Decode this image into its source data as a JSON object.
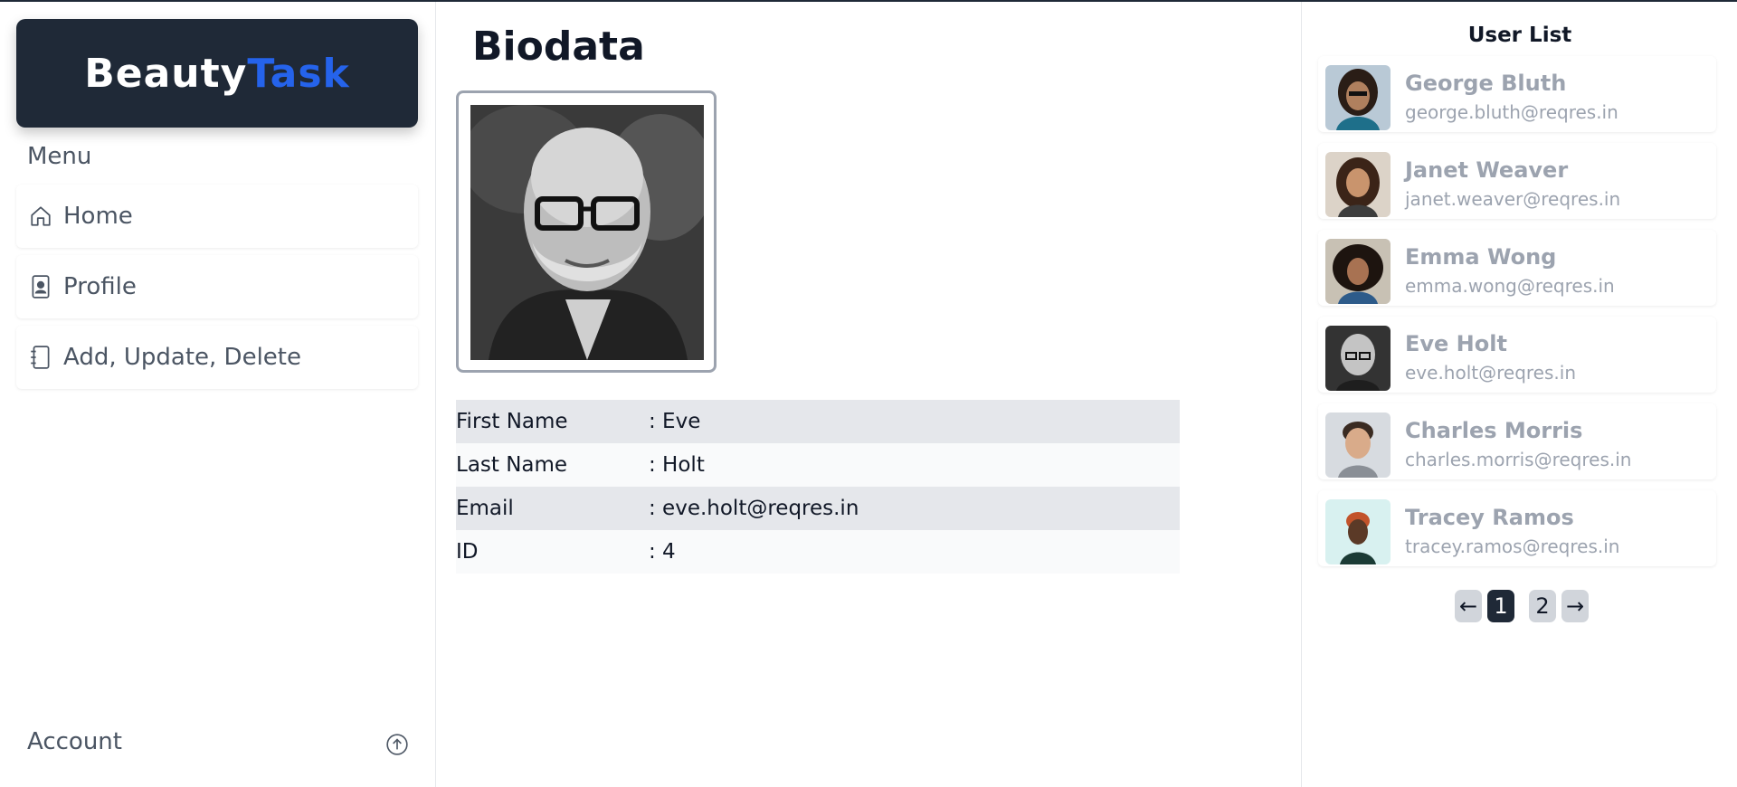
{
  "brand": {
    "part1": "Beauty",
    "part2": "Task",
    "part2_color": "#2563eb"
  },
  "sidebar": {
    "menu_title": "Menu",
    "items": [
      {
        "label": "Home",
        "icon": "home-icon"
      },
      {
        "label": "Profile",
        "icon": "profile-icon"
      },
      {
        "label": "Add, Update, Delete",
        "icon": "notebook-icon"
      }
    ],
    "account_label": "Account",
    "account_icon": "arrow-up-circle-icon"
  },
  "main": {
    "title": "Biodata",
    "biodata": [
      {
        "key": "First Name",
        "value": ": Eve"
      },
      {
        "key": "Last Name",
        "value": ": Holt"
      },
      {
        "key": "Email",
        "value": ": eve.holt@reqres.in"
      },
      {
        "key": "ID",
        "value": ": 4"
      }
    ]
  },
  "user_list": {
    "title": "User List",
    "users": [
      {
        "name": "George Bluth",
        "email": "george.bluth@reqres.in"
      },
      {
        "name": "Janet Weaver",
        "email": "janet.weaver@reqres.in"
      },
      {
        "name": "Emma Wong",
        "email": "emma.wong@reqres.in"
      },
      {
        "name": "Eve Holt",
        "email": "eve.holt@reqres.in"
      },
      {
        "name": "Charles Morris",
        "email": "charles.morris@reqres.in"
      },
      {
        "name": "Tracey Ramos",
        "email": "tracey.ramos@reqres.in"
      }
    ],
    "pagination": {
      "prev": "←",
      "pages": [
        "1",
        "2"
      ],
      "next": "→",
      "active_page": "1"
    }
  },
  "colors": {
    "dark": "#1f2937",
    "accent": "#2563eb",
    "muted": "#9ca3af"
  }
}
